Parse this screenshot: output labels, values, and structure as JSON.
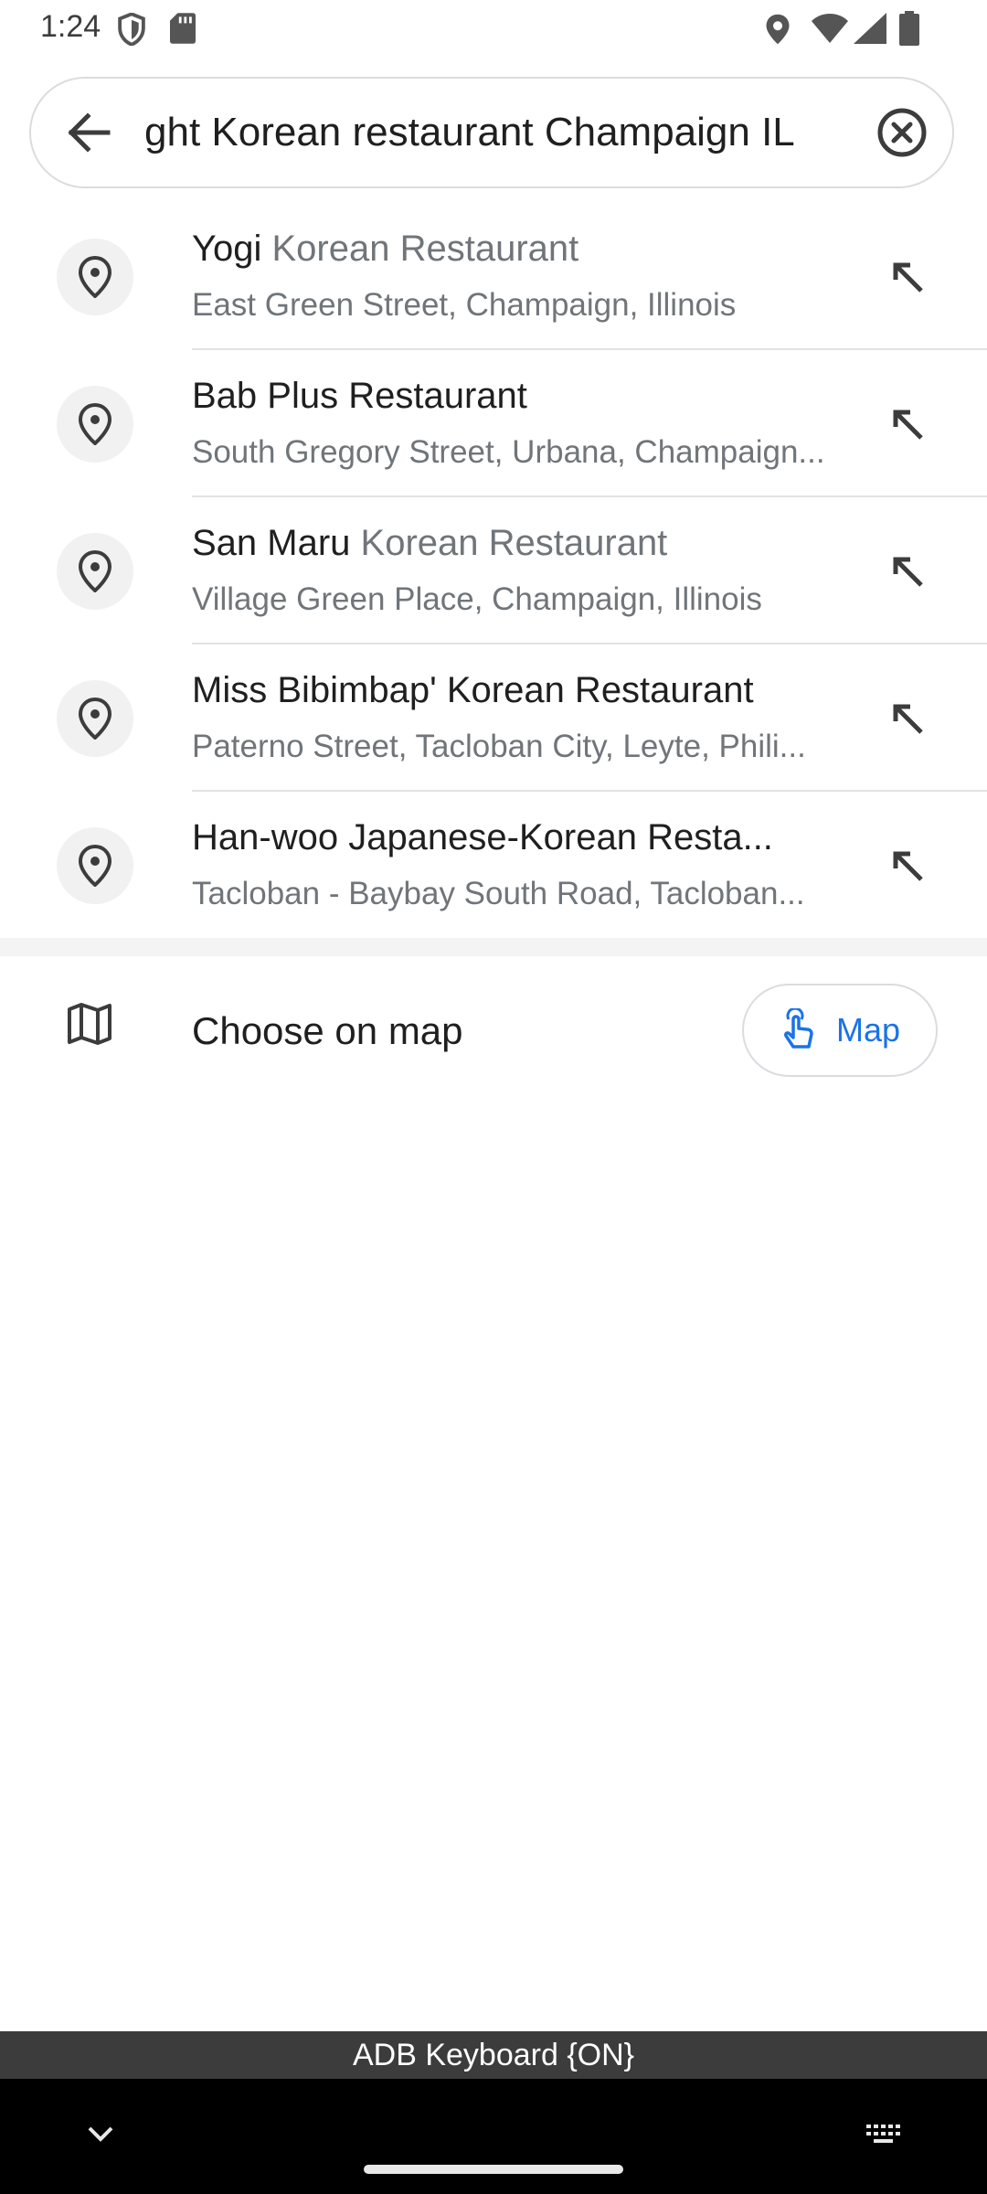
{
  "status_bar": {
    "time": "1:24"
  },
  "search": {
    "value": "ght Korean restaurant Champaign IL"
  },
  "suggestions": [
    {
      "title_main": "Yogi",
      "title_muted": " Korean Restaurant",
      "subtitle": "East Green Street, Champaign, Illinois"
    },
    {
      "title_main": "Bab Plus Restaurant",
      "title_muted": "",
      "subtitle": "South Gregory Street, Urbana, Champaign..."
    },
    {
      "title_main": "San Maru",
      "title_muted": " Korean Restaurant",
      "subtitle": "Village Green Place, Champaign, Illinois"
    },
    {
      "title_main": "Miss Bibimbap' Korean Restaurant",
      "title_muted": "",
      "subtitle": "Paterno Street, Tacloban City, Leyte, Phili..."
    },
    {
      "title_main": "Han-woo Japanese-Korean Resta...",
      "title_muted": "",
      "subtitle": "Tacloban - Baybay South Road, Tacloban..."
    }
  ],
  "choose_on_map": {
    "label": "Choose on map",
    "button_label": "Map"
  },
  "keyboard": {
    "indicator": "ADB Keyboard {ON}"
  },
  "colors": {
    "accent": "#1a73e8",
    "muted_text": "#70757a",
    "pin_bg": "#f1f1f1"
  },
  "icons": {
    "back": "arrow-left-icon",
    "clear": "clear-x-circle-icon",
    "suggestion": "location-pin-icon",
    "fill_query": "arrow-up-left-icon",
    "map": "folded-map-icon",
    "map_button": "touch-pointer-icon"
  }
}
